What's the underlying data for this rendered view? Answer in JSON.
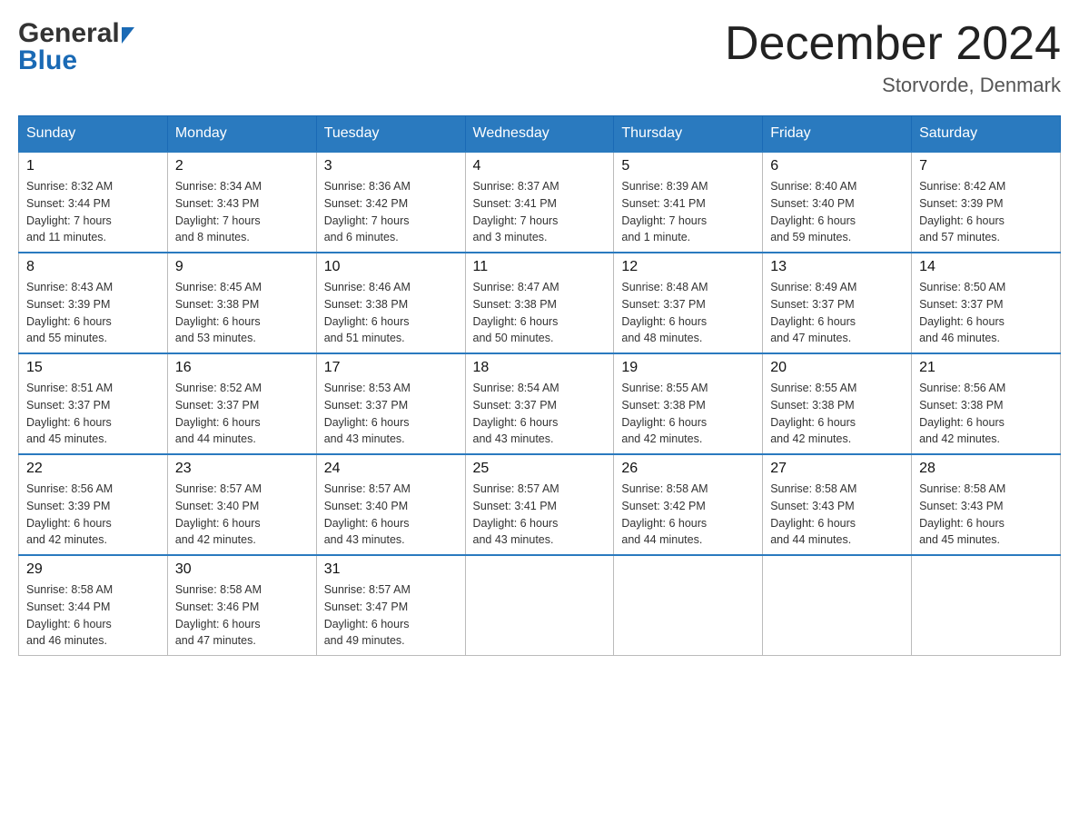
{
  "header": {
    "logo_general": "General",
    "logo_blue": "Blue",
    "month_title": "December 2024",
    "location": "Storvorde, Denmark"
  },
  "days_of_week": [
    "Sunday",
    "Monday",
    "Tuesday",
    "Wednesday",
    "Thursday",
    "Friday",
    "Saturday"
  ],
  "weeks": [
    [
      {
        "num": "1",
        "sunrise": "8:32 AM",
        "sunset": "3:44 PM",
        "daylight": "7 hours and 11 minutes."
      },
      {
        "num": "2",
        "sunrise": "8:34 AM",
        "sunset": "3:43 PM",
        "daylight": "7 hours and 8 minutes."
      },
      {
        "num": "3",
        "sunrise": "8:36 AM",
        "sunset": "3:42 PM",
        "daylight": "7 hours and 6 minutes."
      },
      {
        "num": "4",
        "sunrise": "8:37 AM",
        "sunset": "3:41 PM",
        "daylight": "7 hours and 3 minutes."
      },
      {
        "num": "5",
        "sunrise": "8:39 AM",
        "sunset": "3:41 PM",
        "daylight": "7 hours and 1 minute."
      },
      {
        "num": "6",
        "sunrise": "8:40 AM",
        "sunset": "3:40 PM",
        "daylight": "6 hours and 59 minutes."
      },
      {
        "num": "7",
        "sunrise": "8:42 AM",
        "sunset": "3:39 PM",
        "daylight": "6 hours and 57 minutes."
      }
    ],
    [
      {
        "num": "8",
        "sunrise": "8:43 AM",
        "sunset": "3:39 PM",
        "daylight": "6 hours and 55 minutes."
      },
      {
        "num": "9",
        "sunrise": "8:45 AM",
        "sunset": "3:38 PM",
        "daylight": "6 hours and 53 minutes."
      },
      {
        "num": "10",
        "sunrise": "8:46 AM",
        "sunset": "3:38 PM",
        "daylight": "6 hours and 51 minutes."
      },
      {
        "num": "11",
        "sunrise": "8:47 AM",
        "sunset": "3:38 PM",
        "daylight": "6 hours and 50 minutes."
      },
      {
        "num": "12",
        "sunrise": "8:48 AM",
        "sunset": "3:37 PM",
        "daylight": "6 hours and 48 minutes."
      },
      {
        "num": "13",
        "sunrise": "8:49 AM",
        "sunset": "3:37 PM",
        "daylight": "6 hours and 47 minutes."
      },
      {
        "num": "14",
        "sunrise": "8:50 AM",
        "sunset": "3:37 PM",
        "daylight": "6 hours and 46 minutes."
      }
    ],
    [
      {
        "num": "15",
        "sunrise": "8:51 AM",
        "sunset": "3:37 PM",
        "daylight": "6 hours and 45 minutes."
      },
      {
        "num": "16",
        "sunrise": "8:52 AM",
        "sunset": "3:37 PM",
        "daylight": "6 hours and 44 minutes."
      },
      {
        "num": "17",
        "sunrise": "8:53 AM",
        "sunset": "3:37 PM",
        "daylight": "6 hours and 43 minutes."
      },
      {
        "num": "18",
        "sunrise": "8:54 AM",
        "sunset": "3:37 PM",
        "daylight": "6 hours and 43 minutes."
      },
      {
        "num": "19",
        "sunrise": "8:55 AM",
        "sunset": "3:38 PM",
        "daylight": "6 hours and 42 minutes."
      },
      {
        "num": "20",
        "sunrise": "8:55 AM",
        "sunset": "3:38 PM",
        "daylight": "6 hours and 42 minutes."
      },
      {
        "num": "21",
        "sunrise": "8:56 AM",
        "sunset": "3:38 PM",
        "daylight": "6 hours and 42 minutes."
      }
    ],
    [
      {
        "num": "22",
        "sunrise": "8:56 AM",
        "sunset": "3:39 PM",
        "daylight": "6 hours and 42 minutes."
      },
      {
        "num": "23",
        "sunrise": "8:57 AM",
        "sunset": "3:40 PM",
        "daylight": "6 hours and 42 minutes."
      },
      {
        "num": "24",
        "sunrise": "8:57 AM",
        "sunset": "3:40 PM",
        "daylight": "6 hours and 43 minutes."
      },
      {
        "num": "25",
        "sunrise": "8:57 AM",
        "sunset": "3:41 PM",
        "daylight": "6 hours and 43 minutes."
      },
      {
        "num": "26",
        "sunrise": "8:58 AM",
        "sunset": "3:42 PM",
        "daylight": "6 hours and 44 minutes."
      },
      {
        "num": "27",
        "sunrise": "8:58 AM",
        "sunset": "3:43 PM",
        "daylight": "6 hours and 44 minutes."
      },
      {
        "num": "28",
        "sunrise": "8:58 AM",
        "sunset": "3:43 PM",
        "daylight": "6 hours and 45 minutes."
      }
    ],
    [
      {
        "num": "29",
        "sunrise": "8:58 AM",
        "sunset": "3:44 PM",
        "daylight": "6 hours and 46 minutes."
      },
      {
        "num": "30",
        "sunrise": "8:58 AM",
        "sunset": "3:46 PM",
        "daylight": "6 hours and 47 minutes."
      },
      {
        "num": "31",
        "sunrise": "8:57 AM",
        "sunset": "3:47 PM",
        "daylight": "6 hours and 49 minutes."
      },
      null,
      null,
      null,
      null
    ]
  ],
  "labels": {
    "sunrise": "Sunrise:",
    "sunset": "Sunset:",
    "daylight": "Daylight:"
  }
}
